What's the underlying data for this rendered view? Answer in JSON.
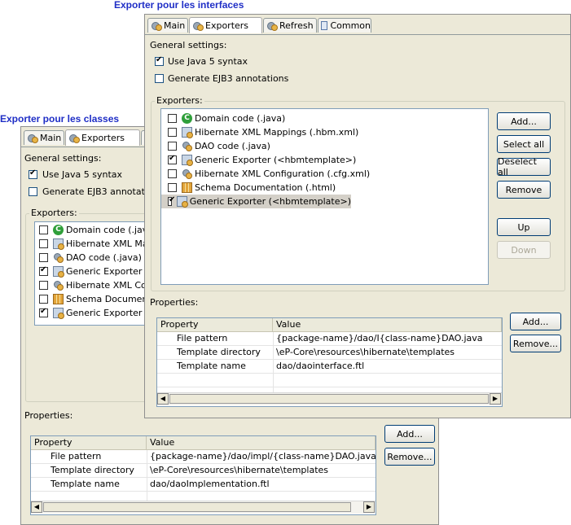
{
  "captions": {
    "interfaces": "Exporter pour les interfaces",
    "classes": "Exporter pour les classes"
  },
  "back_panel": {
    "tabs": [
      "Main",
      "Exporters"
    ],
    "general_settings": "General settings:",
    "use_java5": {
      "label": "Use Java 5 syntax",
      "checked": true
    },
    "generate_ejb3": {
      "label": "Generate EJB3 annotatior",
      "checked": false
    },
    "exporters_label": "Exporters:",
    "exporters": [
      {
        "label": "Domain code (.java",
        "icon": "java-class-icon",
        "checked": false
      },
      {
        "label": "Hibernate XML Map",
        "icon": "hibernate-icon",
        "checked": false
      },
      {
        "label": "DAO code (.java)",
        "icon": "dao-icon",
        "checked": false
      },
      {
        "label": "Generic Exporter (",
        "icon": "hibernate-icon",
        "checked": true
      },
      {
        "label": "Hibernate XML Con",
        "icon": "dao-icon",
        "checked": false
      },
      {
        "label": "Schema Documenta",
        "icon": "schema-icon",
        "checked": false
      },
      {
        "label": "Generic Exporter (",
        "icon": "hibernate-icon",
        "checked": true
      }
    ],
    "properties_label": "Properties:",
    "table_headers": [
      "Property",
      "Value"
    ],
    "table_rows": [
      [
        "File pattern",
        "{package-name}/dao/impl/{class-name}DAO.java"
      ],
      [
        "Template directory",
        "\\eP-Core\\resources\\hibernate\\templates"
      ],
      [
        "Template name",
        "dao/daoImplementation.ftl"
      ]
    ],
    "buttons": {
      "add": "Add...",
      "remove": "Remove..."
    }
  },
  "front_panel": {
    "tabs": [
      "Main",
      "Exporters",
      "Refresh",
      "Common"
    ],
    "general_settings": "General settings:",
    "use_java5": {
      "label": "Use Java 5 syntax",
      "checked": true
    },
    "generate_ejb3": {
      "label": "Generate EJB3 annotations",
      "checked": false
    },
    "exporters_label": "Exporters:",
    "exporters": [
      {
        "label": "Domain code (.java)",
        "icon": "java-class-icon",
        "checked": false
      },
      {
        "label": "Hibernate XML Mappings (.hbm.xml)",
        "icon": "hibernate-icon",
        "checked": false
      },
      {
        "label": "DAO code (.java)",
        "icon": "dao-icon",
        "checked": false
      },
      {
        "label": "Generic Exporter (<hbmtemplate>)",
        "icon": "hibernate-icon",
        "checked": true
      },
      {
        "label": "Hibernate XML Configuration (.cfg.xml)",
        "icon": "dao-icon",
        "checked": false
      },
      {
        "label": "Schema Documentation (.html)",
        "icon": "schema-icon",
        "checked": false
      },
      {
        "label": "Generic Exporter (<hbmtemplate>)",
        "icon": "hibernate-icon",
        "checked": true
      }
    ],
    "side_buttons": {
      "add": "Add...",
      "select_all": "Select all",
      "deselect_all": "Deselect all",
      "remove": "Remove",
      "up": "Up",
      "down": "Down"
    },
    "properties_label": "Properties:",
    "table_headers": [
      "Property",
      "Value"
    ],
    "table_rows": [
      [
        "File pattern",
        "{package-name}/dao/I{class-name}DAO.java"
      ],
      [
        "Template directory",
        "\\eP-Core\\resources\\hibernate\\templates"
      ],
      [
        "Template name",
        "dao/daointerface.ftl"
      ]
    ],
    "buttons": {
      "add": "Add...",
      "remove": "Remove..."
    }
  }
}
